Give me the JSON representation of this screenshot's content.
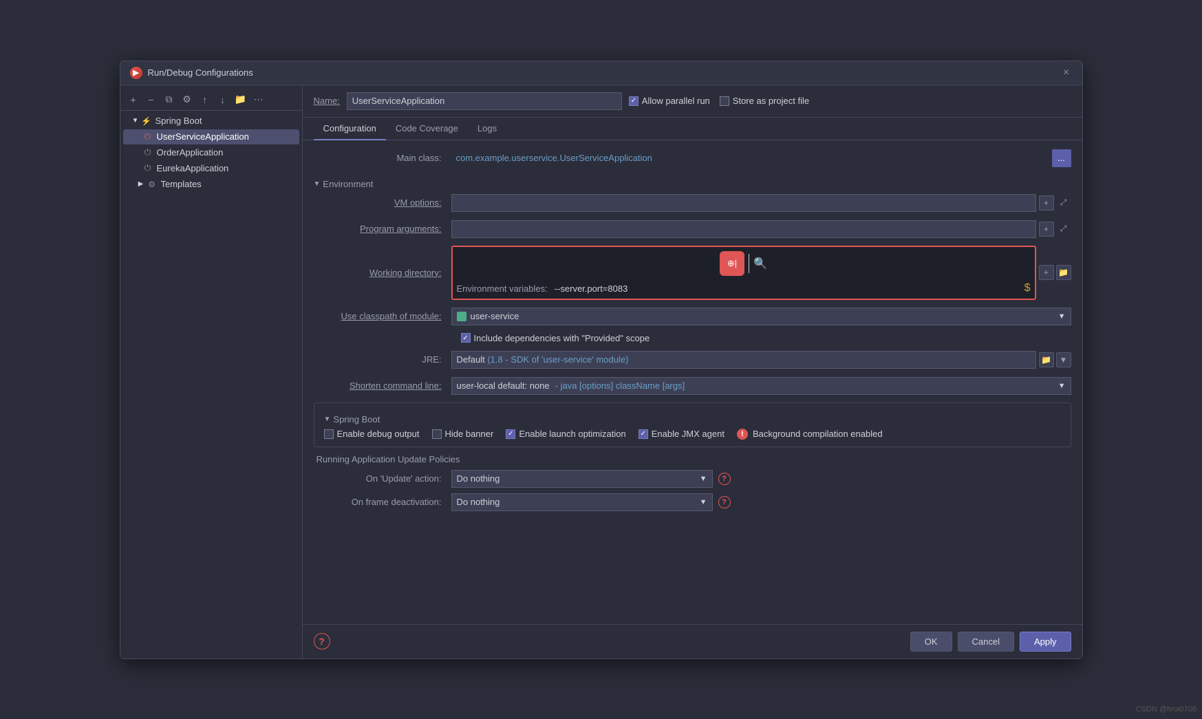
{
  "window": {
    "title": "Run/Debug Configurations",
    "close_btn": "×"
  },
  "toolbar": {
    "add_icon": "+",
    "remove_icon": "−",
    "copy_icon": "⧉",
    "settings_icon": "⚙",
    "up_icon": "↑",
    "down_icon": "↓",
    "add_folder_icon": "📁",
    "more_icon": "⋯"
  },
  "sidebar": {
    "springboot_label": "Spring Boot",
    "user_service_app": "UserServiceApplication",
    "order_app": "OrderApplication",
    "eureka_app": "EurekaApplication",
    "templates_label": "Templates"
  },
  "header": {
    "name_label": "Name:",
    "name_value": "UserServiceApplication",
    "allow_parallel_run": "Allow parallel run",
    "store_as_project_file": "Store as project file"
  },
  "tabs": {
    "configuration": "Configuration",
    "code_coverage": "Code Coverage",
    "logs": "Logs"
  },
  "form": {
    "main_class_label": "Main class:",
    "main_class_value": "com.example.userservice.UserServiceApplication",
    "environment_section": "Environment",
    "vm_options_label": "VM options:",
    "program_args_label": "Program arguments:",
    "working_dir_label": "Working directory:",
    "env_vars_label": "Environment variables:",
    "env_vars_value": "--server.port=8083",
    "use_classpath_label": "Use classpath of module:",
    "module_value": "user-service",
    "include_deps_label": "Include dependencies with \"Provided\" scope",
    "jre_label": "JRE:",
    "jre_default": "Default",
    "jre_sdk": "(1.8 - SDK of 'user-service' module)",
    "shorten_cmd_label": "Shorten command line:",
    "shorten_none": "user-local default: none",
    "shorten_java": "- java [options] className [args]",
    "browse_btn": "...",
    "plus_icon": "+",
    "expand_icon": "⤢"
  },
  "spring_boot": {
    "section_label": "Spring Boot",
    "enable_debug": "Enable debug output",
    "hide_banner": "Hide banner",
    "enable_launch_opt": "Enable launch optimization",
    "enable_jmx": "Enable JMX agent",
    "bg_compilation": "Background compilation enabled"
  },
  "running_app_policies": {
    "title": "Running Application Update Policies",
    "on_update_label": "On 'Update' action:",
    "on_update_value": "Do nothing",
    "on_frame_label": "On frame deactivation:",
    "on_frame_value": "Do nothing"
  },
  "bottom": {
    "ok_label": "OK",
    "cancel_label": "Cancel",
    "apply_label": "Apply",
    "help_icon": "?"
  },
  "watermark": "CSDN @hrui0706"
}
